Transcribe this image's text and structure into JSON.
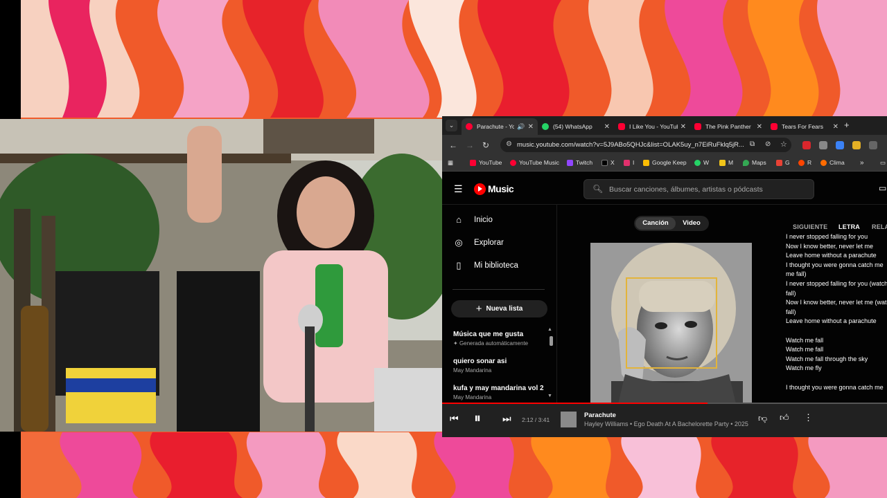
{
  "browser": {
    "tabs": [
      {
        "title": "Parachute - YouTube Music",
        "color": "#ff0033",
        "active": true
      },
      {
        "title": "(54) WhatsApp",
        "color": "#25d366",
        "active": false
      },
      {
        "title": "I Like You - YouTube",
        "color": "#ff0033",
        "active": false
      },
      {
        "title": "The Pink Panther",
        "color": "#ff0033",
        "active": false
      },
      {
        "title": "Tears For Fears",
        "color": "#ff0033",
        "active": false
      }
    ],
    "url": "music.youtube.com/watch?v=5J9ABo5QHJc&list=OLAK5uy_n7EiRuFklq5jR...",
    "bookmarks": [
      {
        "label": "YouTube",
        "color": "#ff0033"
      },
      {
        "label": "YouTube Music",
        "color": "#ff0033"
      },
      {
        "label": "Twitch",
        "color": "#9146ff"
      },
      {
        "label": "X",
        "color": "#000000"
      },
      {
        "label": "I",
        "color": "#e1306c"
      },
      {
        "label": "Google Keep",
        "color": "#fbbc04"
      },
      {
        "label": "W",
        "color": "#25d366"
      },
      {
        "label": "M",
        "color": "#f0c419"
      },
      {
        "label": "Maps",
        "color": "#34a853"
      },
      {
        "label": "G",
        "color": "#e94235"
      },
      {
        "label": "R",
        "color": "#ff4500"
      },
      {
        "label": "Clima",
        "color": "#ff6b00"
      }
    ],
    "bookmarks_more": "»"
  },
  "ytm": {
    "logo": "Music",
    "search_placeholder": "Buscar canciones, álbumes, artistas o pódcasts",
    "nav": [
      {
        "label": "Inicio",
        "icon": "home-icon"
      },
      {
        "label": "Explorar",
        "icon": "explore-icon"
      },
      {
        "label": "Mi biblioteca",
        "icon": "library-icon"
      }
    ],
    "new_playlist": "Nueva lista",
    "playlists": [
      {
        "title": "Música que me gusta",
        "subtitle": "Generada automáticamente"
      },
      {
        "title": "quiero sonar asi",
        "subtitle": "May Mandarina"
      },
      {
        "title": "kufa y may mandarina vol 2",
        "subtitle": "May Mandarina"
      }
    ],
    "toggle": {
      "song": "Canción",
      "video": "Video"
    },
    "right_tabs": {
      "next": "SIGUIENTE",
      "lyrics": "LETRA",
      "related": "RELACIONADO"
    },
    "lyrics": [
      "I never stopped falling for you",
      "Now I know better, never let me",
      "Leave home without a parachute",
      "I thought you were gonna catch me",
      "me fall)",
      "I never stopped falling for you (watch me",
      "fall)",
      "Now I know better, never let me (watch me",
      "fall)",
      "Leave home without a parachute",
      "",
      "Watch me fall",
      "Watch me fall",
      "Watch me fall through the sky",
      "Watch me fly",
      "",
      "I thought you were gonna catch me"
    ]
  },
  "player": {
    "time": "2:12 / 3:41",
    "progress": 0.597,
    "title": "Parachute",
    "subtitle": "Hayley Williams • Ego Death At A Bachelorette Party • 2025"
  }
}
